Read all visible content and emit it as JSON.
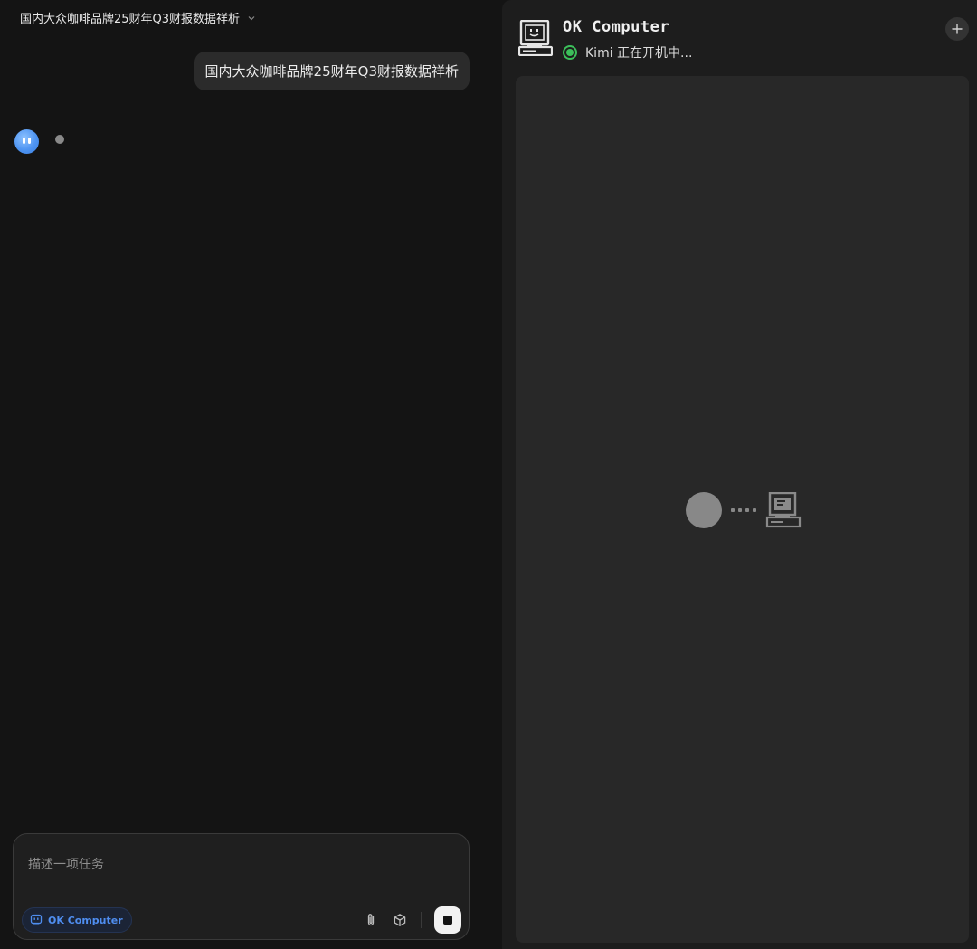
{
  "chat": {
    "title": "国内大众咖啡品牌25财年Q3财报数据祥析",
    "user_message": "国内大众咖啡品牌25财年Q3财报数据祥析",
    "composer": {
      "placeholder": "描述一项任务",
      "mode_chip": "OK Computer"
    }
  },
  "computer": {
    "title": "OK Computer",
    "status": "Kimi 正在开机中...",
    "status_color": "#3cbf5a",
    "accent_color": "#4f8ef0"
  },
  "icons": {
    "title_dropdown": "chevron-down-icon",
    "avatar": "kimi-avatar",
    "attach": "paperclip-icon",
    "tools": "cube-icon",
    "stop": "stop-icon",
    "header": "retro-computer-icon",
    "new": "plus-icon"
  }
}
